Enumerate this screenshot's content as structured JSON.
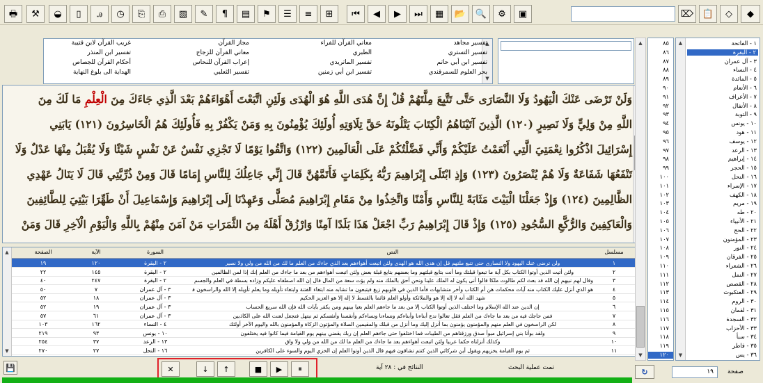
{
  "toolbar": {
    "buttons": [
      {
        "name": "print-icon",
        "glyph": "🖶"
      },
      {
        "name": "tools-icon",
        "glyph": "⚒"
      },
      {
        "name": "disk-icon",
        "glyph": "◒"
      },
      {
        "name": "new-doc-icon",
        "glyph": "▯"
      },
      {
        "name": "font-icon",
        "glyph": "ꭿ"
      },
      {
        "name": "timer-icon",
        "glyph": "◷"
      },
      {
        "name": "copy-icon",
        "glyph": "⎘"
      },
      {
        "name": "export-icon",
        "glyph": "⎙"
      },
      {
        "name": "image-icon",
        "glyph": "▧"
      },
      {
        "name": "pencil-icon",
        "glyph": "✎"
      },
      {
        "name": "bookmark-icon",
        "glyph": "¶"
      },
      {
        "name": "book-icon",
        "glyph": "▤"
      },
      {
        "name": "flag-icon",
        "glyph": "⚑"
      },
      {
        "name": "align-right-icon",
        "glyph": "☰"
      },
      {
        "name": "justify-icon",
        "glyph": "≡"
      },
      {
        "name": "open-book-icon",
        "glyph": "⊞"
      },
      {
        "name": "first-icon",
        "glyph": "⏮"
      },
      {
        "name": "prev-icon",
        "glyph": "◀"
      },
      {
        "name": "next-icon",
        "glyph": "▶"
      },
      {
        "name": "last-icon",
        "glyph": "⏭"
      },
      {
        "name": "page-icon",
        "glyph": "▦"
      },
      {
        "name": "folder-icon",
        "glyph": "📂"
      },
      {
        "name": "find-icon",
        "glyph": "🔍"
      },
      {
        "name": "settings-icon",
        "glyph": "⚙"
      },
      {
        "name": "grid-icon",
        "glyph": "▣"
      },
      {
        "name": "paste-icon",
        "glyph": "⌦"
      },
      {
        "name": "clipboard-icon",
        "glyph": "📋"
      },
      {
        "name": "diamond-outline-icon",
        "glyph": "◇"
      },
      {
        "name": "diamond-icon",
        "glyph": "◆"
      }
    ]
  },
  "tafsir_sources": {
    "col1": [
      "تفسير مجاهد",
      "تفسير التستري",
      "تفسير ابن أبي حاتم",
      "بحر العلوم للسمرقندي"
    ],
    "col2": [
      "معاني القرآن للفراء",
      "الطبري",
      "تفسير الماتريدي",
      "تفسير ابن أبي زمنين"
    ],
    "col3": [
      "مجاز القرآن",
      "معاني القرآن للزجاج",
      "إعراب القرآن للنحاس",
      "تفسير الثعلبي"
    ],
    "col4": [
      "غريب القرآن لابن قتيبة",
      "تفسير ابن المنذر",
      "أحكام القرآن للجصاص",
      "الهداية الى بلوغ النهاية"
    ]
  },
  "quran_text": {
    "line1_a": "وَلَنْ تَرْضَى عَنْكَ الْيَهُودُ وَلَا النَّصَارَى حَتَّى تَتَّبِعَ مِلَّتَهُمْ قُلْ إِنَّ هُدَى اللَّهِ هُوَ الْهُدَى وَلَئِنِ اتَّبَعْتَ أَهْوَاءَهُمْ بَعْدَ الَّذِي جَاءَكَ مِنَ ",
    "line1_red": "الْعِلْمِ",
    "line1_b": " مَا لَكَ مِنَ",
    "line2": "اللَّهِ مِنْ وَلِيٍّ وَلَا نَصِيرٍ (١٢٠) الَّذِينَ آتَيْنَاهُمُ الْكِتَابَ يَتْلُونَهُ حَقَّ تِلَاوَتِهِ أُولَئِكَ يُؤْمِنُونَ بِهِ وَمَنْ يَكْفُرْ بِهِ فَأُولَئِكَ هُمُ الْخَاسِرُونَ (١٢١) يَابَنِي",
    "line3": "إِسْرَائِيلَ اذْكُرُوا نِعْمَتِيَ الَّتِي أَنْعَمْتُ عَلَيْكُمْ وَأَنِّي فَضَّلْتُكُمْ عَلَى الْعَالَمِينَ (١٢٢) وَاتَّقُوا يَوْمًا لَا تَجْزِي نَفْسٌ عَنْ نَفْسٍ شَيْئًا وَلَا يُقْبَلُ مِنْهَا عَدْلٌ وَلَا",
    "line4": "تَنْفَعُهَا شَفَاعَةٌ وَلَا هُمْ يُنْصَرُونَ (١٢٣) وَإِذِ ابْتَلَى إِبْرَاهِيمَ رَبُّهُ بِكَلِمَاتٍ فَأَتَمَّهُنَّ قَالَ إِنِّي جَاعِلُكَ لِلنَّاسِ إِمَامًا قَالَ وَمِنْ ذُرِّيَّتِي قَالَ لَا يَنَالُ عَهْدِي",
    "line5": "الظَّالِمِينَ (١٢٤) وَإِذْ جَعَلْنَا الْبَيْتَ مَثَابَةً لِلنَّاسِ وَأَمْنًا وَاتَّخِذُوا مِنْ مَقَامِ إِبْرَاهِيمَ مُصَلًّى وَعَهِدْنَا إِلَى إِبْرَاهِيمَ وَإِسْمَاعِيلَ أَنْ طَهِّرَا بَيْتِيَ لِلطَّائِفِينَ",
    "line6": "وَالْعَاكِفِينَ وَالرُّكَّعِ السُّجُودِ (١٢٥) وَإِذْ قَالَ إِبْرَاهِيمُ رَبِّ اجْعَلْ هَذَا بَلَدًا آمِنًا وَارْزُقْ أَهْلَهُ مِنَ الثَّمَرَاتِ مَنْ آمَنَ مِنْهُمْ بِاللَّهِ وَالْيَوْمِ الْآخِرِ قَالَ وَمَنْ"
  },
  "results_table": {
    "headers": {
      "page": "الصفحة",
      "aya": "الآية",
      "sura": "السورة",
      "text": "النص",
      "serial": "مسلسل"
    },
    "rows": [
      {
        "page": "١٩",
        "aya": "١٢٠",
        "sura": "٢ - البقرة",
        "text": "ولن ترضى عنك اليهود ولا النصارى حتى تتبع ملتهم قل إن هدى الله هو الهدى ولئن اتبعت أهواءهم بعد الذي جاءك من العلم ما لك من الله من ولي ولا نصير",
        "serial": "١"
      },
      {
        "page": "٢٢",
        "aya": "١٤٥",
        "sura": "٢ - البقرة",
        "text": "ولئن أتيت الذين أوتوا الكتاب بكل آية ما تبعوا قبلتك وما أنت بتابع قبلتهم وما بعضهم بتابع قبلة بعض ولئن اتبعت أهواءهم من بعد ما جاءك من العلم إنك إذا لمن الظالمين",
        "serial": "٢"
      },
      {
        "page": "٤٠",
        "aya": "٢٤٧",
        "sura": "٢ - البقرة",
        "text": "وقال لهم نبيهم إن الله قد بعث لكم طالوت ملكا قالوا أنى يكون له الملك علينا ونحن أحق بالملك منه ولم يؤت سعة من المال قال إن الله اصطفاه عليكم وزاده بسطة في العلم والجسم والله يؤتي ملكه من يشاء والله واسع عليم",
        "serial": "٣"
      },
      {
        "page": "٥٠",
        "aya": "٧",
        "sura": "٣ - آل عمران",
        "text": "هو الذي أنزل عليك الكتاب منه آيات محكمات هن أم الكتاب وأخر متشابهات فأما الذين في قلوبهم زيغ فيتبعون ما تشابه منه ابتغاء الفتنة وابتغاء تأويله وما يعلم تأويله إلا الله والراسخون في العلم يقولون آمنا به كل من عند ربنا وما يذكر إلا أولو الألباب",
        "serial": "٤"
      },
      {
        "page": "٥٢",
        "aya": "١٨",
        "sura": "٣ - آل عمران",
        "text": "شهد الله أنه لا إله إلا هو والملائكة وأولو العلم قائما بالقسط لا إله إلا هو العزيز الحكيم",
        "serial": "٥"
      },
      {
        "page": "٥٢",
        "aya": "١٩",
        "sura": "٣ - آل عمران",
        "text": "إن الدين عند الله الإسلام وما اختلف الذين أوتوا الكتاب إلا من بعد ما جاءهم العلم بغيا بينهم ومن يكفر بآيات الله فإن الله سريع الحساب",
        "serial": "٦"
      },
      {
        "page": "٥٧",
        "aya": "٦١",
        "sura": "٣ - آل عمران",
        "text": "فمن حاجك فيه من بعد ما جاءك من العلم فقل تعالوا ندع أبناءنا وأبناءكم ونساءنا ونساءكم وأنفسنا وأنفسكم ثم نبتهل فنجعل لعنت الله على الكاذبين",
        "serial": "٧"
      },
      {
        "page": "١٠٣",
        "aya": "١٦٢",
        "sura": "٤ - النساء",
        "text": "لكن الراسخون في العلم منهم والمؤمنون يؤمنون بما أنزل إليك وما أنزل من قبلك والمقيمين الصلاة والمؤتون الزكاة والمؤمنون بالله واليوم الآخر أولئك",
        "serial": "٨"
      },
      {
        "page": "٢١٩",
        "aya": "٩٣",
        "sura": "١٠ - يونس",
        "text": "ولقد بوأنا بني إسرائيل مبوأ صدق ورزقناهم من الطيبات فما اختلفوا حتى جاءهم العلم إن ربك يقضي بينهم يوم القيامة فيما كانوا فيه يختلفون",
        "serial": "٩"
      },
      {
        "page": "٢٥٤",
        "aya": "٣٧",
        "sura": "١٣ - الرعد",
        "text": "وكذلك أنزلناه حكما عربيا ولئن اتبعت أهواءهم بعد ما جاءك من العلم ما لك من الله من ولي ولا واق",
        "serial": "١٠"
      },
      {
        "page": "٢٧٠",
        "aya": "٢٧",
        "sura": "١٦ - النحل",
        "text": "ثم يوم القيامة يخزيهم ويقول أين شركائي الذين كنتم تشاقون فيهم قال الذين أوتوا العلم إن الخزي اليوم والسوء على الكافرين",
        "serial": "١١"
      }
    ]
  },
  "sura_list": {
    "items": [
      "١ - الفاتحة",
      "٢ - البقرة",
      "٣ - آل عمران",
      "٤ - النساء",
      "٥ - المائدة",
      "٦ - الأنعام",
      "٧ - الأعراف",
      "٨ - الأنفال",
      "٩ - التوبة",
      "١٠ - يونس",
      "١١ - هود",
      "١٢ - يوسف",
      "١٣ - الرعد",
      "١٤ - إبراهيم",
      "١٥ - الحجر",
      "١٦ - النحل",
      "١٧ - الإسراء",
      "١٨ - الكهف",
      "١٩ - مريم",
      "٢٠ - طه",
      "٢١ - الأنبياء",
      "٢٢ - الحج",
      "٢٣ - المؤمنون",
      "٢٤ - النور",
      "٢٥ - الفرقان",
      "٢٦ - الشعراء",
      "٢٧ - النمل",
      "٢٨ - القصص",
      "٢٩ - العنكبوت",
      "٣٠ - الروم",
      "٣١ - لقمان",
      "٣٢ - السجدة",
      "٣٣ - الأحزاب",
      "٣٤ - سبأ",
      "٣٥ - فاطر",
      "٣٦ - يس"
    ],
    "selected_index": 1
  },
  "aya_numbers": {
    "items": [
      "٨٥",
      "٨٦",
      "٨٧",
      "٨٨",
      "٨٩",
      "٩٠",
      "٩١",
      "٩٢",
      "٩٣",
      "٩٤",
      "٩٥",
      "٩٦",
      "٩٧",
      "٩٨",
      "٩٩",
      "١٠٠",
      "١٠١",
      "١٠٢",
      "١٠٣",
      "١٠٤",
      "١٠٥",
      "١٠٦",
      "١٠٧",
      "١٠٨",
      "١٠٩",
      "١١٠",
      "١١١",
      "١١٢",
      "١١٣",
      "١١٤",
      "١١٥",
      "١١٦",
      "١١٧",
      "١١٨",
      "١١٩",
      "١٢٠"
    ],
    "selected_index": 35
  },
  "bottom": {
    "results_label": "النتائج في : ٢٨ آية",
    "status_label": "تمت عملية البحث",
    "page_value": "١٩",
    "page_label": "صفحة"
  },
  "colors": {
    "selection": "#3169c6",
    "quran_text": "#3b2f17",
    "highlight": "#c00000",
    "progress": "#13b016"
  }
}
